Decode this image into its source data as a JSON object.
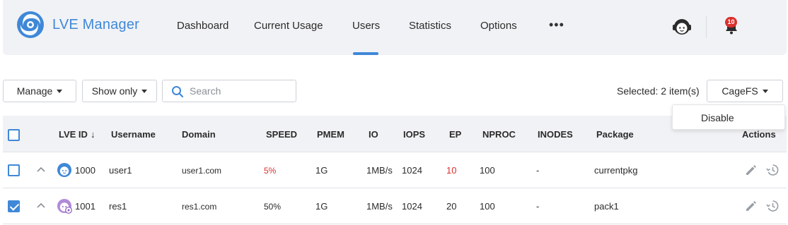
{
  "app": {
    "title": "LVE Manager"
  },
  "nav": {
    "items": [
      {
        "label": "Dashboard"
      },
      {
        "label": "Current Usage"
      },
      {
        "label": "Users"
      },
      {
        "label": "Statistics"
      },
      {
        "label": "Options"
      }
    ],
    "active": "Users",
    "more": "•••",
    "notification_count": "10"
  },
  "toolbar": {
    "manage_label": "Manage",
    "show_only_label": "Show only",
    "search_placeholder": "Search",
    "search_value": "",
    "selected_text": "Selected: 2 item(s)",
    "cagefs_label": "CageFS"
  },
  "dropdown": {
    "items": [
      {
        "label": "Disable"
      }
    ]
  },
  "table": {
    "headers": {
      "lve_id": "LVE ID",
      "sort_arrow": "↓",
      "username": "Username",
      "domain": "Domain",
      "speed": "SPEED",
      "pmem": "PMEM",
      "io": "IO",
      "iops": "IOPS",
      "ep": "EP",
      "nproc": "NPROC",
      "inodes": "INODES",
      "package": "Package",
      "actions": "Actions"
    },
    "rows": [
      {
        "checked": false,
        "lve_id": "1000",
        "username": "user1",
        "domain": "user1.com",
        "speed": "5%",
        "pmem": "1G",
        "io": "1MB/s",
        "iops": "1024",
        "ep": "10",
        "nproc": "100",
        "inodes": "-",
        "package": "currentpkg"
      },
      {
        "checked": true,
        "lve_id": "1001",
        "username": "res1",
        "domain": "res1.com",
        "speed": "50%",
        "pmem": "1G",
        "io": "1MB/s",
        "iops": "1024",
        "ep": "20",
        "nproc": "100",
        "inodes": "-",
        "package": "pack1"
      }
    ]
  },
  "colors": {
    "accent": "#3f88d8",
    "alert": "#d9302d",
    "header_bg": "#f1f2f5"
  }
}
